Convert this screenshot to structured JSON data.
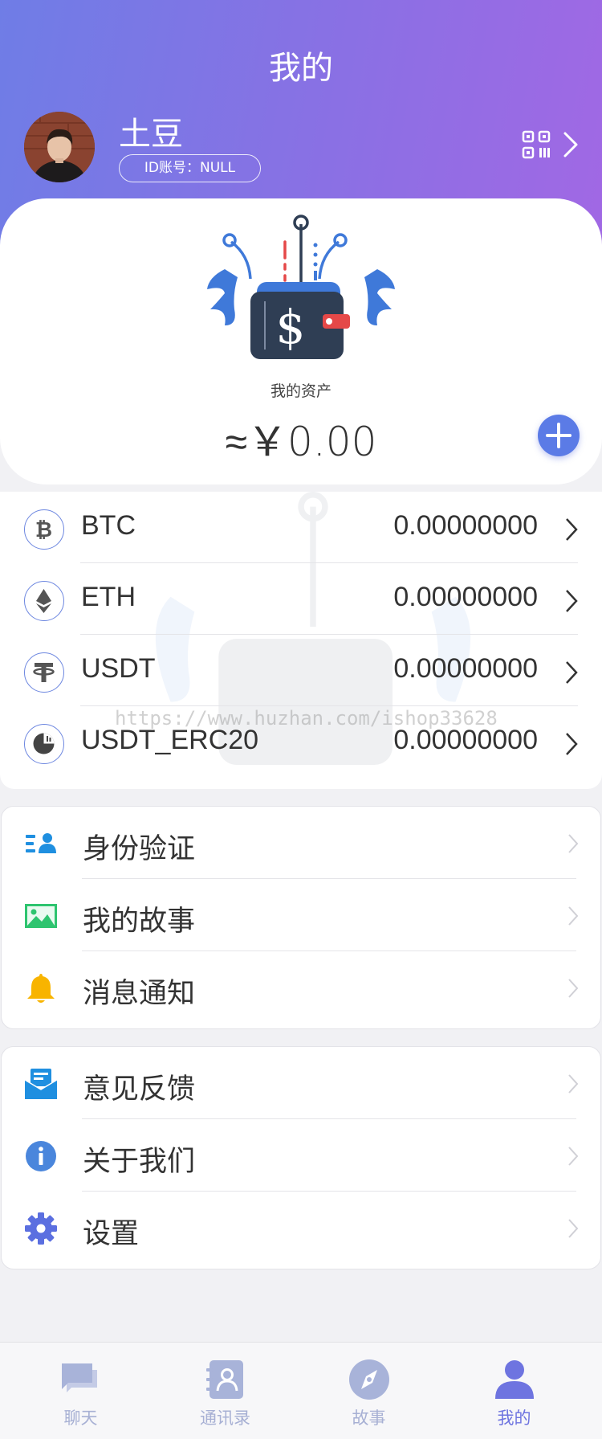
{
  "header": {
    "title": "我的",
    "username": "土豆",
    "id_label": "ID账号：NULL"
  },
  "assets": {
    "label": "我的资产",
    "total": "≈￥0.00"
  },
  "coins": [
    {
      "name": "BTC",
      "balance": "0.00000000",
      "icon": "bitcoin-icon"
    },
    {
      "name": "ETH",
      "balance": "0.00000000",
      "icon": "ethereum-icon"
    },
    {
      "name": "USDT",
      "balance": "0.00000000",
      "icon": "tether-icon"
    },
    {
      "name": "USDT_ERC20",
      "balance": "0.00000000",
      "icon": "erc20-icon"
    }
  ],
  "menu_group_1": [
    {
      "label": "身份验证",
      "icon": "id-verify-icon",
      "color": "#1f8fe0"
    },
    {
      "label": "我的故事",
      "icon": "picture-icon",
      "color": "#2ec46f"
    },
    {
      "label": "消息通知",
      "icon": "bell-icon",
      "color": "#f8b400"
    }
  ],
  "menu_group_2": [
    {
      "label": "意见反馈",
      "icon": "feedback-icon",
      "color": "#1f8fe0"
    },
    {
      "label": "关于我们",
      "icon": "info-icon",
      "color": "#4a86dc"
    },
    {
      "label": "设置",
      "icon": "gear-icon",
      "color": "#5b6fe0"
    }
  ],
  "tabbar": [
    {
      "label": "聊天",
      "icon": "chat-icon",
      "active": false
    },
    {
      "label": "通讯录",
      "icon": "contacts-icon",
      "active": false
    },
    {
      "label": "故事",
      "icon": "compass-icon",
      "active": false
    },
    {
      "label": "我的",
      "icon": "profile-icon",
      "active": true
    }
  ],
  "watermark": "https://www.huzhan.com/ishop33628",
  "colors": {
    "header_gradient_start": "#6f7de6",
    "header_gradient_end": "#a168e4",
    "accent": "#5b7be6",
    "tab_active": "#6e74e0",
    "tab_inactive": "#a7b0d4"
  }
}
